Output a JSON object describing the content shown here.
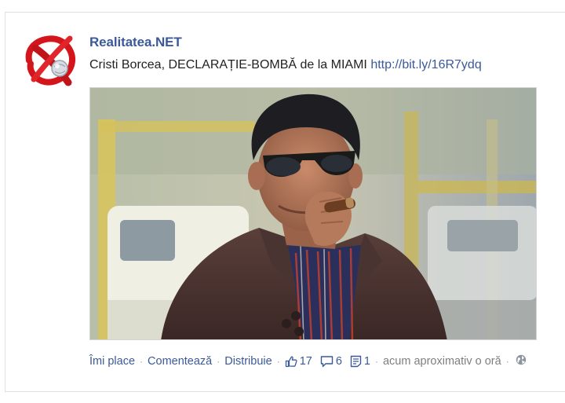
{
  "post": {
    "page_name": "Realitatea.NET",
    "status_text": "Cristi Borcea, DECLARAȚIE-BOMBĂ de la MIAMI",
    "link_text": "http://bit.ly/16R7ydq",
    "actions": {
      "like_label": "Îmi place",
      "comment_label": "Comentează",
      "share_label": "Distribuie",
      "like_count": "17",
      "comment_count": "6",
      "share_count": "1",
      "timestamp": "acum aproximativ o oră"
    },
    "icons": {
      "avatar": "realitatea-logo-icon",
      "like": "thumbs-up-icon",
      "comment": "comment-bubble-icon",
      "share": "share-doc-icon",
      "audience": "globe-icon"
    },
    "colors": {
      "link": "#3b5998",
      "logo_red": "#d4161c"
    }
  }
}
